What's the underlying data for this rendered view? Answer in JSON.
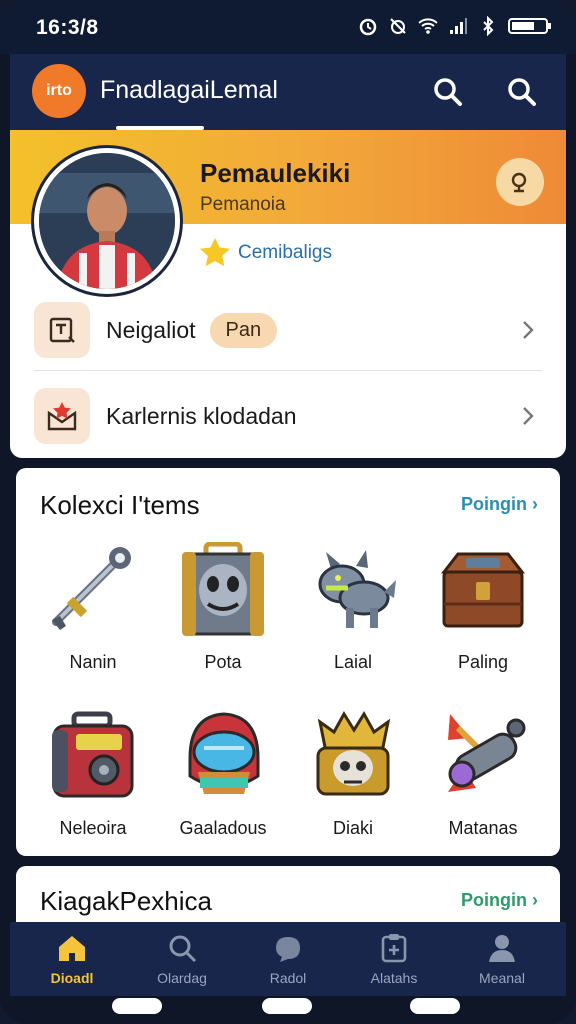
{
  "status": {
    "time": "16:3/8"
  },
  "appbar": {
    "logo_text": "irto",
    "title": "FnadlagaiLemal"
  },
  "profile": {
    "name": "Pemaulekiki",
    "subtitle": "Pemanoia",
    "level": "Cemibaligs",
    "rows": [
      {
        "label": "Neigaliot",
        "pill": "Pan"
      },
      {
        "label": "Karlernis klodadan"
      }
    ]
  },
  "collection": {
    "title": "Kolexci I'tems",
    "link": "Poingin",
    "items": [
      {
        "label": "Nanin",
        "icon": "key-icon"
      },
      {
        "label": "Pota",
        "icon": "chest-monster-icon"
      },
      {
        "label": "Laial",
        "icon": "wolf-creature-icon"
      },
      {
        "label": "Paling",
        "icon": "treasure-chest-icon"
      },
      {
        "label": "Neleoira",
        "icon": "radio-device-icon"
      },
      {
        "label": "Gaaladous",
        "icon": "helmet-icon"
      },
      {
        "label": "Diaki",
        "icon": "skull-crown-icon"
      },
      {
        "label": "Matanas",
        "icon": "cannon-icon"
      }
    ]
  },
  "collection2": {
    "title": "KiagakPexhica",
    "link": "Poingin"
  },
  "nav": [
    {
      "label": "Dioadl",
      "icon": "home-icon",
      "active": true
    },
    {
      "label": "Olardag",
      "icon": "search-icon"
    },
    {
      "label": "Radol",
      "icon": "chat-icon"
    },
    {
      "label": "Alatahs",
      "icon": "clipboard-icon"
    },
    {
      "label": "Meanal",
      "icon": "profile-icon"
    }
  ],
  "colors": {
    "accent": "#f5c43c",
    "appbar": "#17264a",
    "link": "#2b8fb0",
    "banner_start": "#f3c12a",
    "banner_end": "#ef8a37"
  }
}
